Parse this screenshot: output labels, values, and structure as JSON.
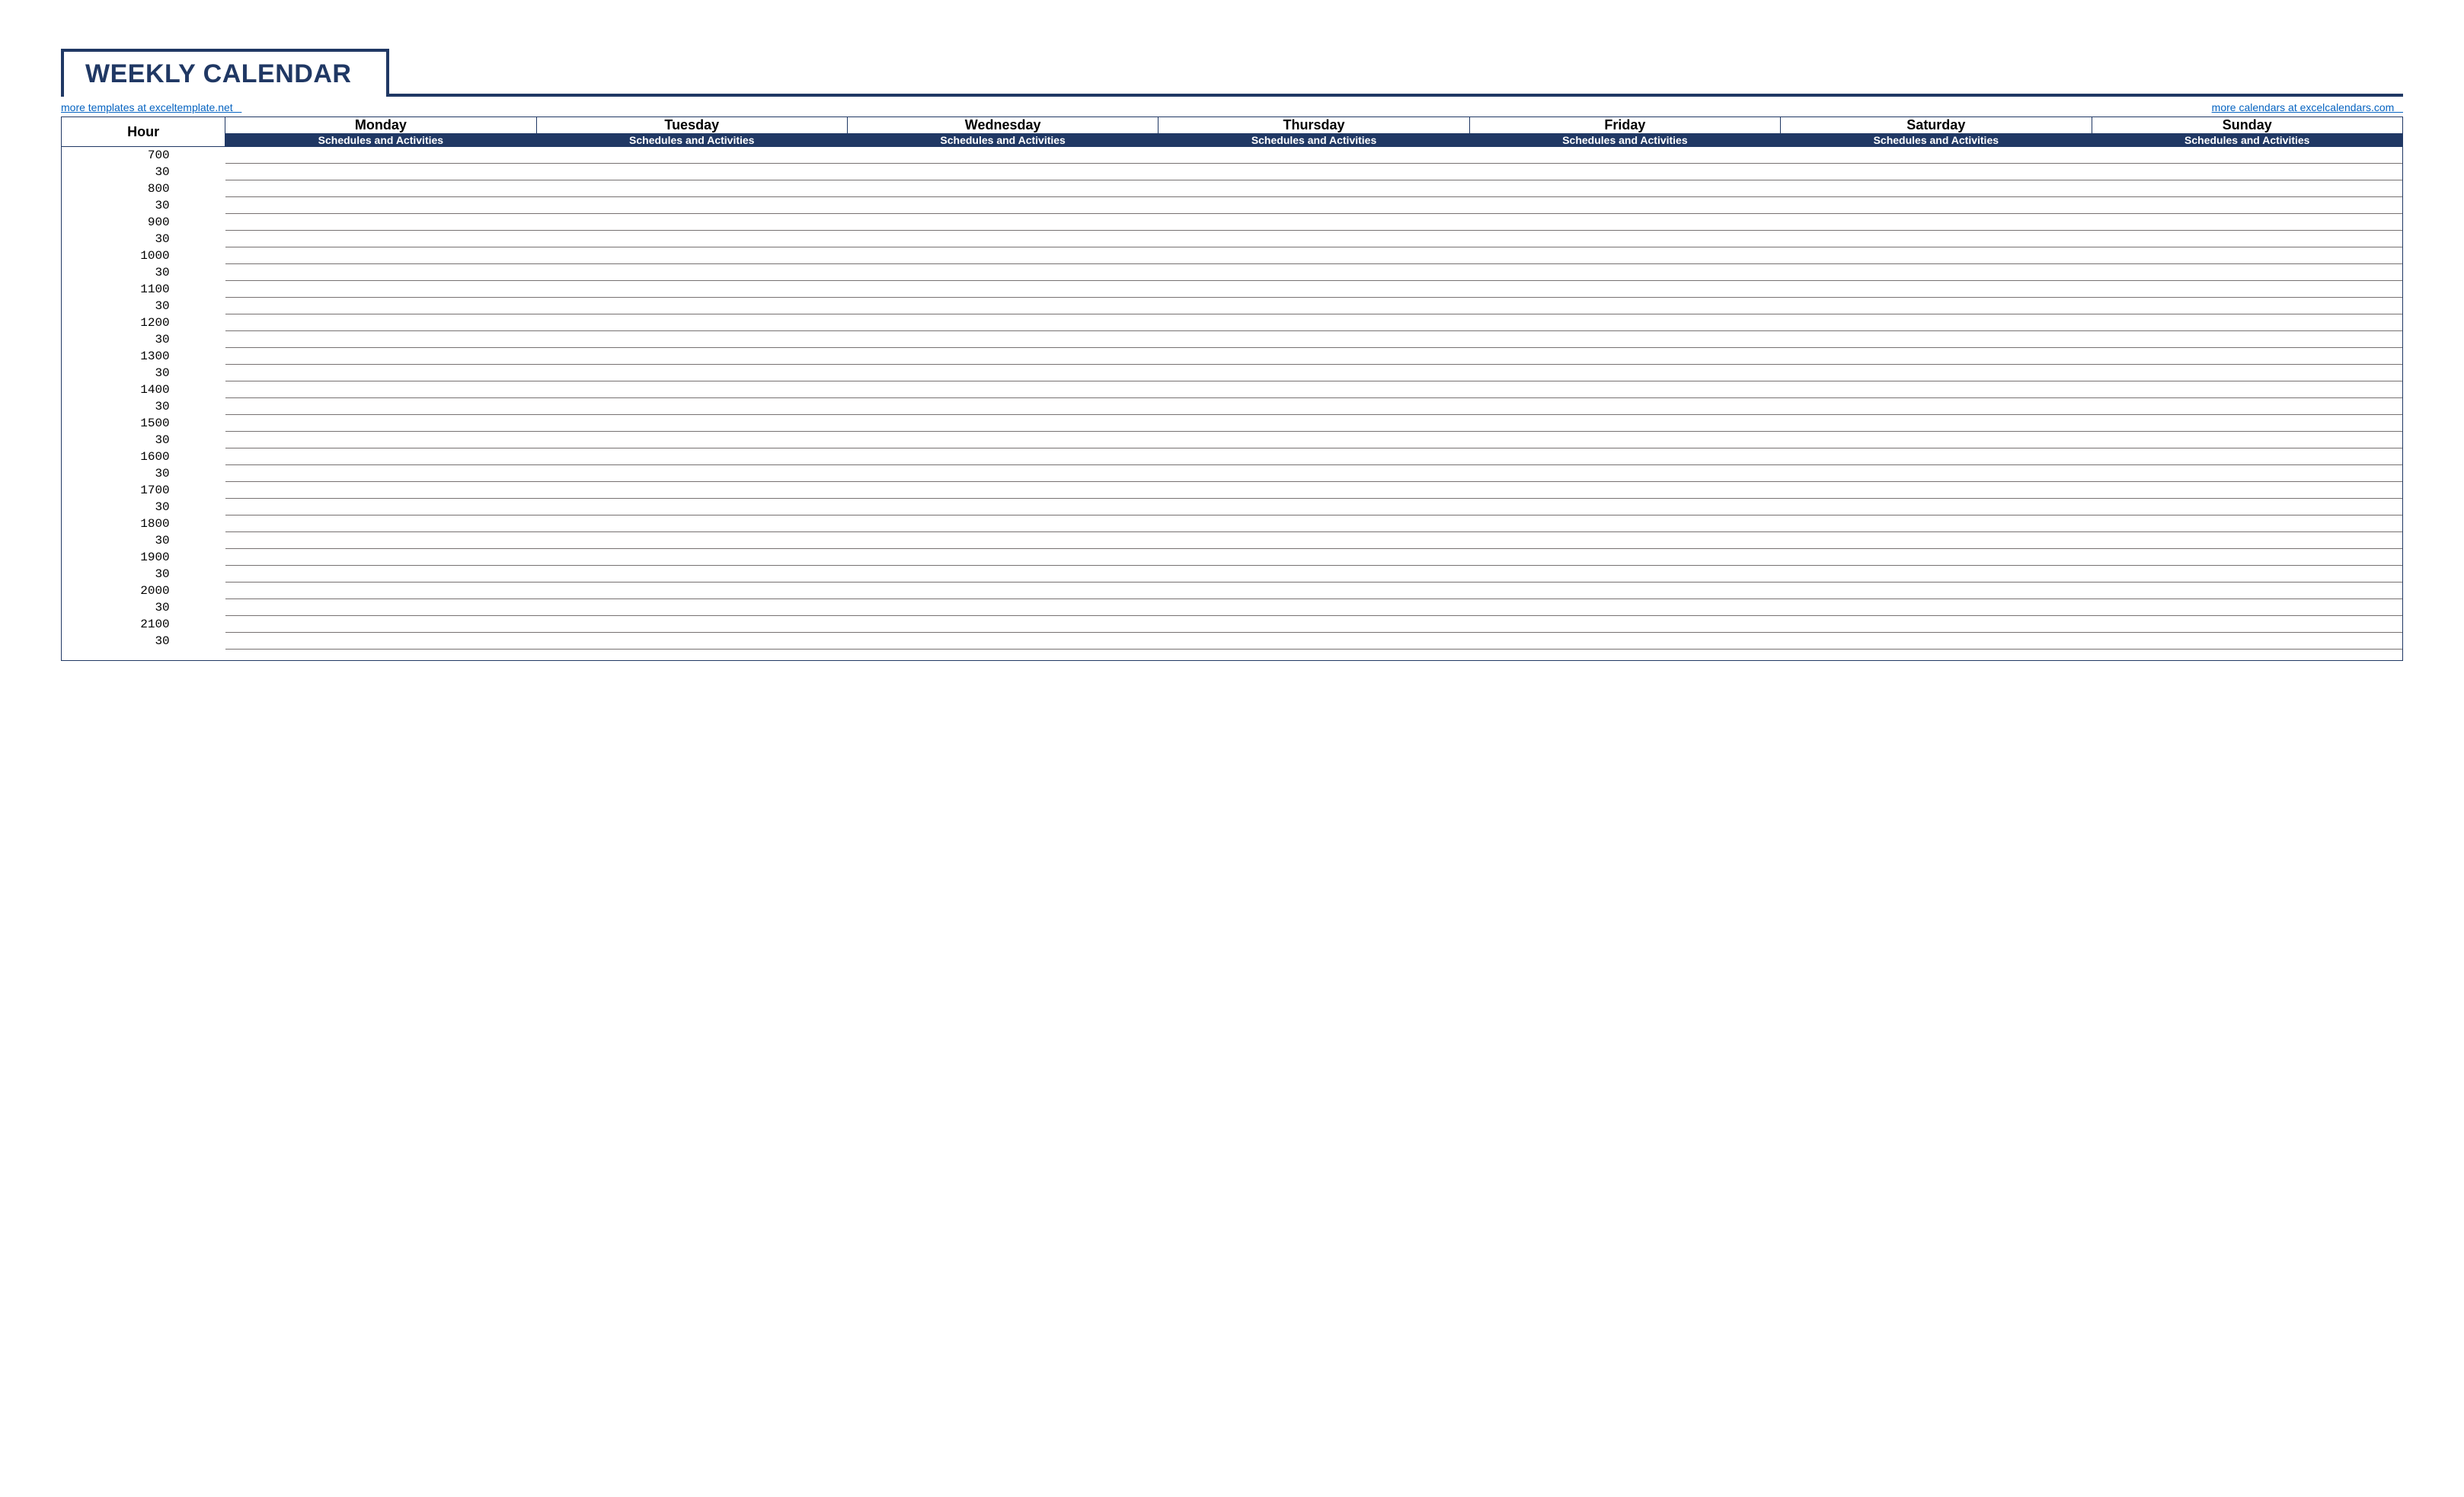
{
  "title": "WEEKLY CALENDAR",
  "links": {
    "left": "more templates at exceltemplate.net   ",
    "right": "more calendars at excelcalendars.com   "
  },
  "header": {
    "hour_label": "Hour",
    "sub_label": "Schedules and Activities"
  },
  "days": [
    "Monday",
    "Tuesday",
    "Wednesday",
    "Thursday",
    "Friday",
    "Saturday",
    "Sunday"
  ],
  "time_rows": [
    {
      "hour": "7",
      "min": "00"
    },
    {
      "hour": "",
      "min": "30"
    },
    {
      "hour": "8",
      "min": "00"
    },
    {
      "hour": "",
      "min": "30"
    },
    {
      "hour": "9",
      "min": "00"
    },
    {
      "hour": "",
      "min": "30"
    },
    {
      "hour": "10",
      "min": "00"
    },
    {
      "hour": "",
      "min": "30"
    },
    {
      "hour": "11",
      "min": "00"
    },
    {
      "hour": "",
      "min": "30"
    },
    {
      "hour": "12",
      "min": "00"
    },
    {
      "hour": "",
      "min": "30"
    },
    {
      "hour": "13",
      "min": "00"
    },
    {
      "hour": "",
      "min": "30"
    },
    {
      "hour": "14",
      "min": "00"
    },
    {
      "hour": "",
      "min": "30"
    },
    {
      "hour": "15",
      "min": "00"
    },
    {
      "hour": "",
      "min": "30"
    },
    {
      "hour": "16",
      "min": "00"
    },
    {
      "hour": "",
      "min": "30"
    },
    {
      "hour": "17",
      "min": "00"
    },
    {
      "hour": "",
      "min": "30"
    },
    {
      "hour": "18",
      "min": "00"
    },
    {
      "hour": "",
      "min": "30"
    },
    {
      "hour": "19",
      "min": "00"
    },
    {
      "hour": "",
      "min": "30"
    },
    {
      "hour": "20",
      "min": "00"
    },
    {
      "hour": "",
      "min": "30"
    },
    {
      "hour": "21",
      "min": "00"
    },
    {
      "hour": "",
      "min": "30"
    }
  ]
}
